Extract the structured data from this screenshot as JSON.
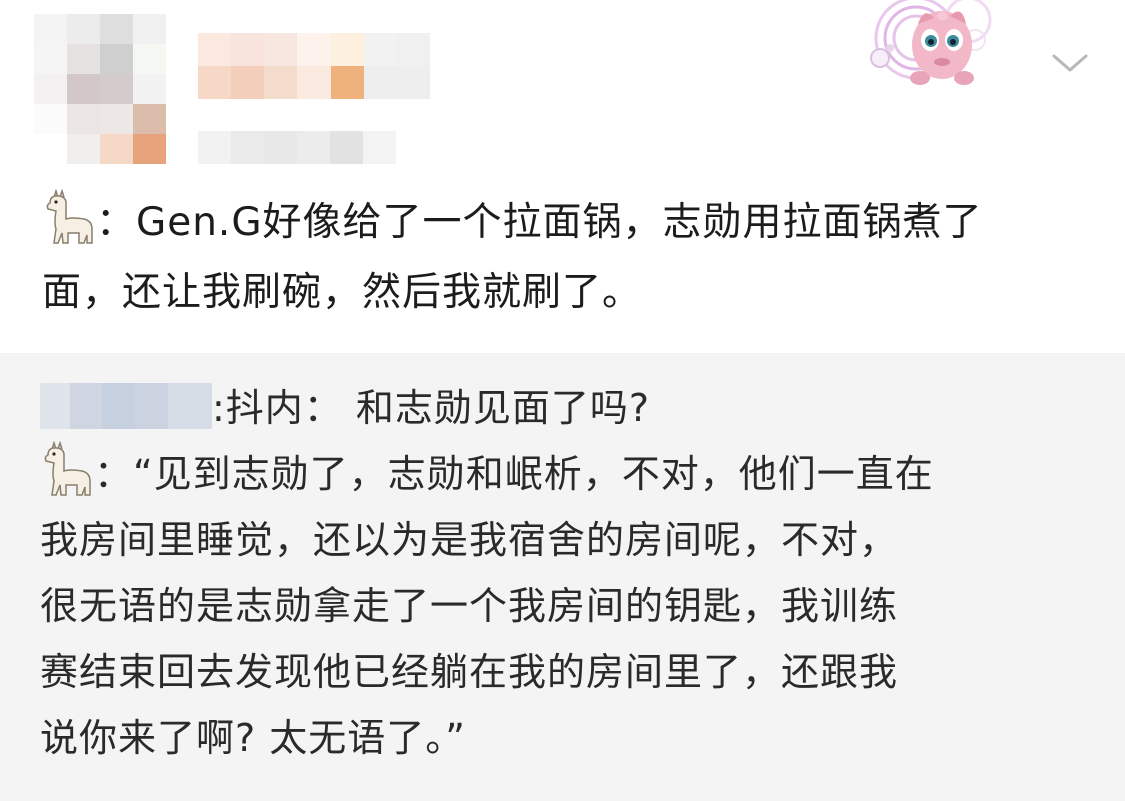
{
  "post": {
    "line1": "：Gen.G好像给了一个拉面锅，志勋用拉面锅煮了",
    "line2": "面，还让我刷碗，然后我就刷了。",
    "emoji_icon": "llama-icon"
  },
  "reply": {
    "question": ":抖内：  和志勋见面了吗?",
    "answer_lines": [
      "：“见到志勋了，志勋和岷析，不对，他们一直在",
      "我房间里睡觉，还以为是我宿舍的房间呢，不对，",
      "很无语的是志勋拿走了一个我房间的钥匙，我训练",
      "赛结束回去发现他已经躺在我的房间里了，还跟我",
      "说你来了啊?  太无语了。”"
    ],
    "emoji_icon": "llama-icon"
  },
  "header": {
    "avatar_icon": "avatar-blurred",
    "badge_icon": "jigglypuff-badge-icon",
    "menu_icon": "chevron-down-icon"
  },
  "colors": {
    "background": "#ffffff",
    "reply_background": "#f4f4f4",
    "text": "#1c1c1c",
    "chevron": "#b8b8b8"
  }
}
